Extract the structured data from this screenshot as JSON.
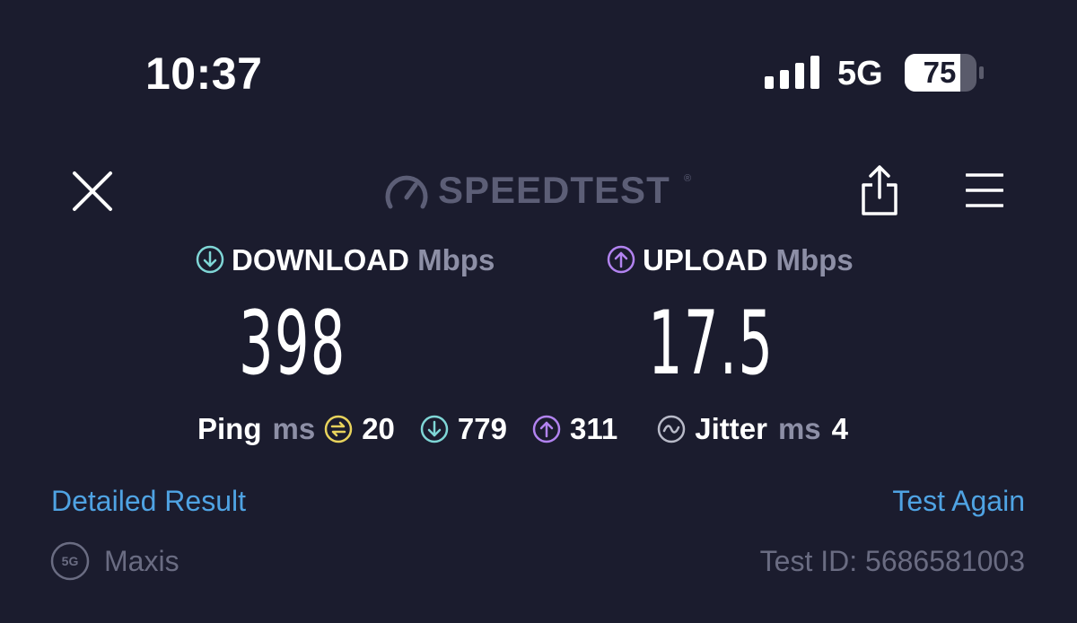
{
  "status_bar": {
    "time": "10:37",
    "network": "5G",
    "battery": "75",
    "battery_level_percent": 75
  },
  "header": {
    "logo_text": "SPEEDTEST",
    "logo_trademark": "®",
    "icons": [
      "close-icon",
      "speedometer-icon",
      "share-icon",
      "menu-icon"
    ]
  },
  "results": {
    "download": {
      "label": "DOWNLOAD",
      "unit": "Mbps",
      "value": "398",
      "icon": "arrow-down-circle-icon",
      "color": "#7fd6d6"
    },
    "upload": {
      "label": "UPLOAD",
      "unit": "Mbps",
      "value": "17.5",
      "icon": "arrow-up-circle-icon",
      "color": "#b283f0"
    }
  },
  "ping": {
    "label": "Ping",
    "unit": "ms",
    "idle": "20",
    "idle_color": "#e8d35c",
    "download": "779",
    "upload": "311",
    "jitter_label": "Jitter",
    "jitter_unit": "ms",
    "jitter": "4"
  },
  "actions": {
    "detailed_result": "Detailed Result",
    "test_again": "Test Again"
  },
  "footer": {
    "carrier_badge": "5G",
    "carrier": "Maxis",
    "test_id": "Test ID: 5686581003"
  },
  "colors": {
    "background": "#1b1c2e",
    "link": "#4fa3e3",
    "muted": "#8d8fa6"
  }
}
